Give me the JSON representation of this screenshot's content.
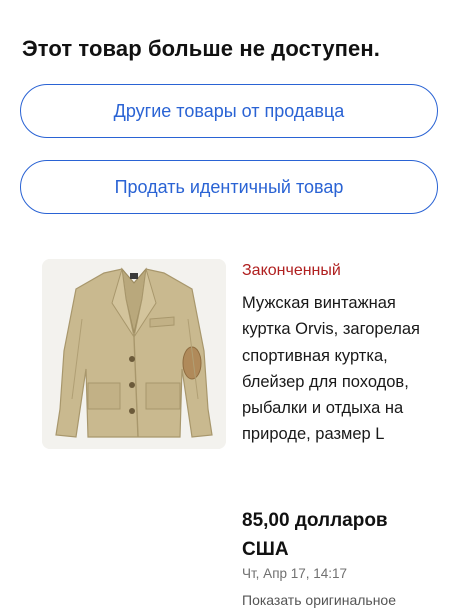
{
  "header": {
    "title": "Этот товар больше не доступен."
  },
  "actions": {
    "other_items_label": "Другие товары от продавца",
    "sell_identical_label": "Продать идентичный товар"
  },
  "listing": {
    "image_icon": "jacket-photo",
    "status": "Законченный",
    "title": "Мужская винтажная куртка Orvis, загорелая спортивная куртка, блейзер для походов, рыбалки и отдыха на природе, размер L",
    "price": "85,00 долларов США",
    "date": "Чт, Апр 17, 14:17",
    "cutoff_text": "Показать оригинальное"
  },
  "colors": {
    "accent": "#2a63d4",
    "status_ended": "#b02020",
    "jacket": "#c9b98f"
  }
}
